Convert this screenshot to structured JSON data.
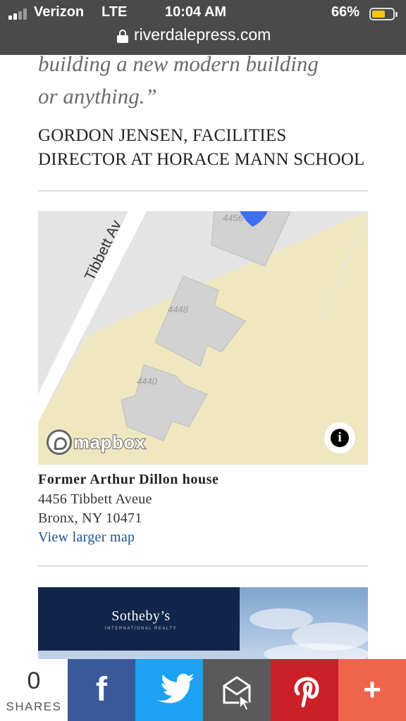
{
  "status_bar": {
    "carrier": "Verizon",
    "network": "LTE",
    "time": "10:04 AM",
    "battery_percent": "66%",
    "battery_level": 0.66,
    "battery_color": "#f5c518",
    "url": "riverdalepress.com"
  },
  "article": {
    "quote_lines": [
      "building a new modern building",
      "or anything.”"
    ],
    "attribution_lines": [
      "GORDON JENSEN, FACILITIES",
      "DIRECTOR AT HORACE MANN SCHOOL"
    ]
  },
  "map": {
    "street_label": "Tibbett Av",
    "building_labels": [
      "4456",
      "4448",
      "4440"
    ],
    "attribution": "mapbox",
    "info_icon": "i",
    "colors": {
      "land": "#e4e4e4",
      "parcel": "#efe7c0",
      "building": "#d2d2d2",
      "road": "#ffffff",
      "marker": "#3f6ff0"
    }
  },
  "location": {
    "title": "Former Arthur Dillon house",
    "address_line1": "4456 Tibbett Aveue",
    "address_line2": "Bronx, NY 10471",
    "link": "View larger map"
  },
  "ad": {
    "brand": "Sotheby’s",
    "brand_sub": "INTERNATIONAL REALTY"
  },
  "share_bar": {
    "count": "0",
    "count_label": "SHARES",
    "buttons": [
      {
        "name": "facebook",
        "icon": "facebook-icon",
        "color": "#3b5998"
      },
      {
        "name": "twitter",
        "icon": "twitter-icon",
        "color": "#1da1f2"
      },
      {
        "name": "email",
        "icon": "envelope-icon",
        "color": "#5a5a5a"
      },
      {
        "name": "pinterest",
        "icon": "pinterest-icon",
        "color": "#cb2027"
      },
      {
        "name": "more",
        "icon": "plus-icon",
        "color": "#f0634c"
      }
    ]
  }
}
